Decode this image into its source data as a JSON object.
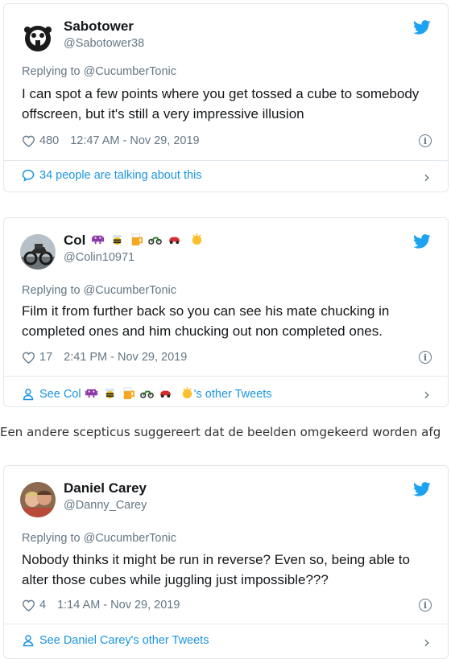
{
  "tweets": [
    {
      "name": "Sabotower",
      "handle": "@Sabotower38",
      "replying": "Replying to @CucumberTonic",
      "text": "I can spot a few points where you get tossed a cube to somebody offscreen, but it's still a very impressive illusion",
      "likes": "480",
      "time": "12:47 AM - Nov 29, 2019",
      "footer": "34 people are talking about this"
    },
    {
      "name": "Col",
      "handle": "@Colin10971",
      "replying": "Replying to @CucumberTonic",
      "text": "Film it from further back so you can see his mate chucking in completed ones and him chucking out non completed ones.",
      "likes": "17",
      "time": "2:41 PM - Nov 29, 2019",
      "footer_prefix": "See Col",
      "footer_suffix": "'s other Tweets"
    },
    {
      "name": "Daniel Carey",
      "handle": "@Danny_Carey",
      "replying": "Replying to @CucumberTonic",
      "text": "Nobody thinks it might be run in reverse? Even so, being able to alter those cubes while juggling just impossible???",
      "likes": "4",
      "time": "1:14 AM - Nov 29, 2019",
      "footer": "See Daniel Carey's other Tweets"
    }
  ],
  "caption": "Een andere scepticus suggereert dat de beelden omgekeerd worden afg",
  "icons": {
    "bird": "twitter-bird-icon",
    "heart": "heart-icon",
    "info": "info-icon",
    "chevron": "chevron-right-icon",
    "speech": "speech-bubble-icon",
    "person": "person-icon"
  },
  "colors": {
    "twitter_blue": "#1da1f2",
    "link_blue": "#1b95e0",
    "gray": "#657786",
    "border": "#e1e8ed"
  }
}
